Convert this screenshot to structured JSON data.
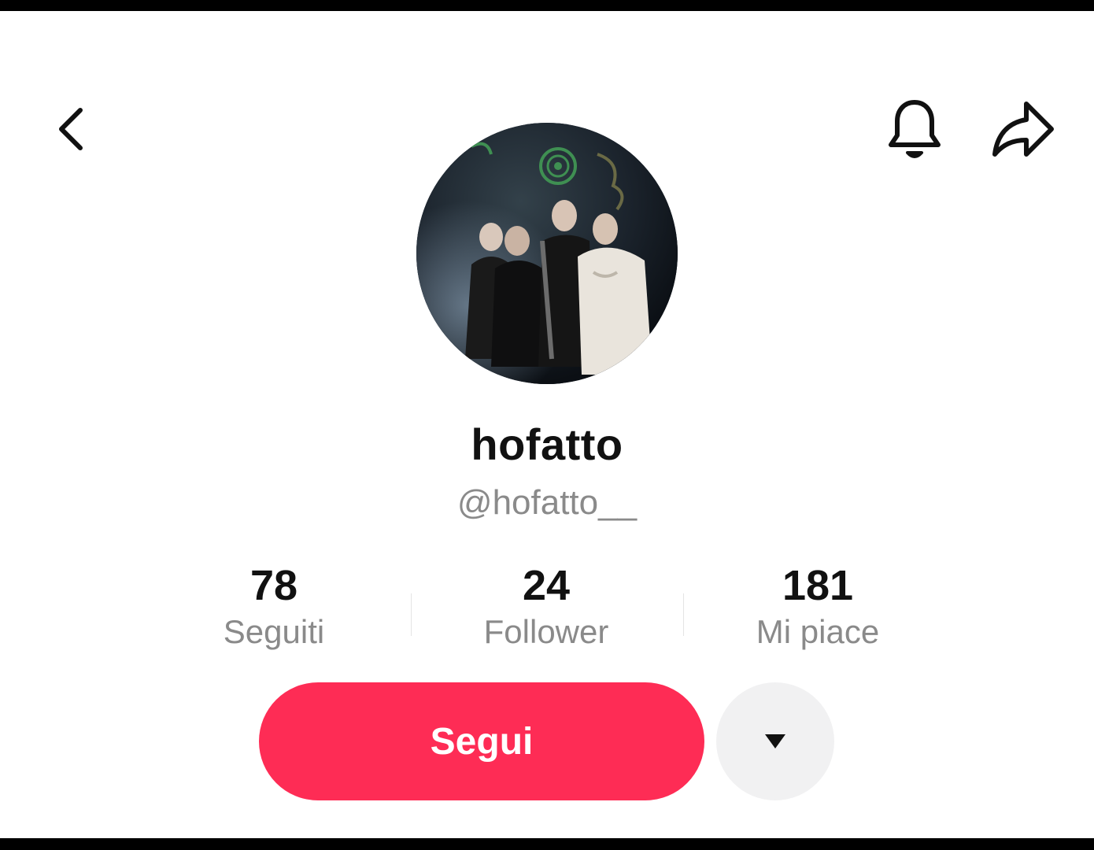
{
  "header": {
    "back_icon": "chevron-left-icon",
    "bell_icon": "bell-icon",
    "share_icon": "share-arrow-icon"
  },
  "profile": {
    "avatar_description": "group-photo-avatar",
    "display_name": "hofatto",
    "username": "@hofatto__"
  },
  "stats": [
    {
      "value": "78",
      "label": "Seguiti"
    },
    {
      "value": "24",
      "label": "Follower"
    },
    {
      "value": "181",
      "label": "Mi piace"
    }
  ],
  "actions": {
    "follow_label": "Segui",
    "more_icon": "caret-down-icon"
  },
  "colors": {
    "accent": "#fe2c55",
    "text_primary": "#111111",
    "text_secondary": "#8a8a8a",
    "secondary_button_bg": "#f1f1f2"
  }
}
